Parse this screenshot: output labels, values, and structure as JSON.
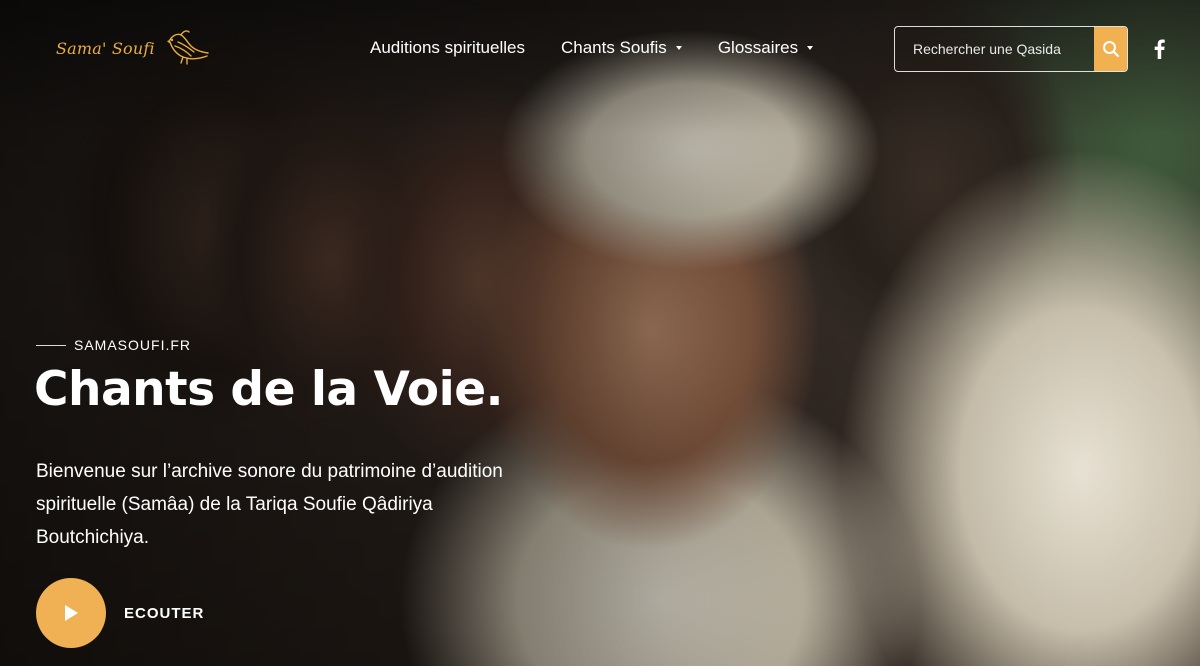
{
  "brand": {
    "name": "Sama' Soufi",
    "logo_icon": "bird-icon",
    "accent_color": "#f2b150"
  },
  "nav": {
    "items": [
      {
        "label": "Auditions spirituelles",
        "has_dropdown": false
      },
      {
        "label": "Chants Soufis",
        "has_dropdown": true
      },
      {
        "label": "Glossaires",
        "has_dropdown": true
      }
    ]
  },
  "search": {
    "placeholder": "Rechercher une Qasida",
    "button_icon": "search-icon"
  },
  "social": {
    "icon": "facebook-icon"
  },
  "hero": {
    "eyebrow": "SAMASOUFI.FR",
    "title": "Chants de la Voie.",
    "description": "Bienvenue sur l’archive sonore du patrimoine d’audition spirituelle (Samâa) de la Tariqa Soufie Qâdiriya Boutchichiya.",
    "cta_label": "ECOUTER",
    "cta_icon": "play-icon"
  }
}
